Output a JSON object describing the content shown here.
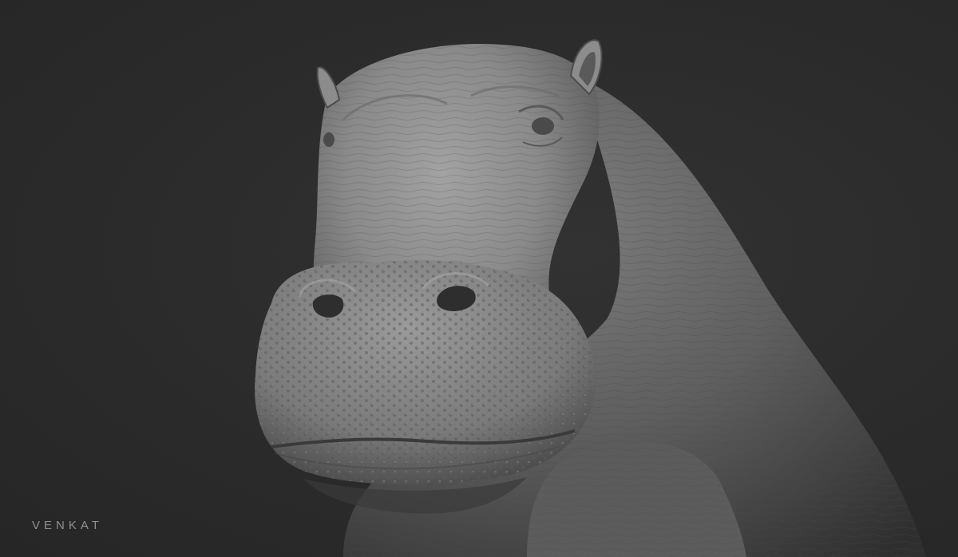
{
  "scene": {
    "subject": "hippo-sculpt-render",
    "background_color": "#2a2a2a",
    "skin_color": "#8a8a8a",
    "shadow_color": "#3a3a3a"
  },
  "watermark": {
    "text": "VENKAT"
  }
}
